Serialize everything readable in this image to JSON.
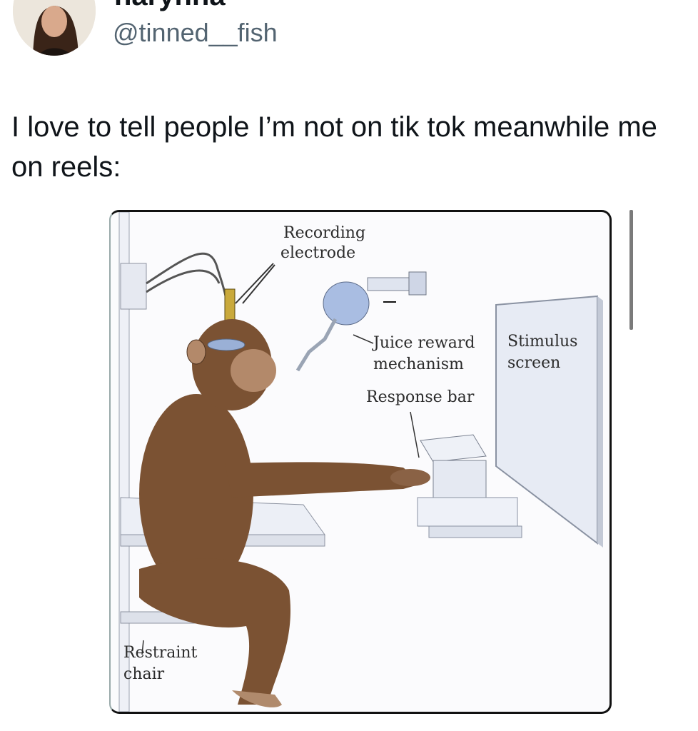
{
  "tweet": {
    "display_name": "harynna",
    "handle": "@tinned__fish",
    "text": "I love to tell people I’m not on tik tok meanwhile me on reels:"
  },
  "image": {
    "labels": {
      "recording": "Recording",
      "electrode": "electrode",
      "juice_reward": "Juice reward",
      "mechanism": "mechanism",
      "stimulus": "Stimulus",
      "screen": "screen",
      "response_bar": "Response bar",
      "restraint": "Restraint",
      "chair": "chair"
    }
  }
}
